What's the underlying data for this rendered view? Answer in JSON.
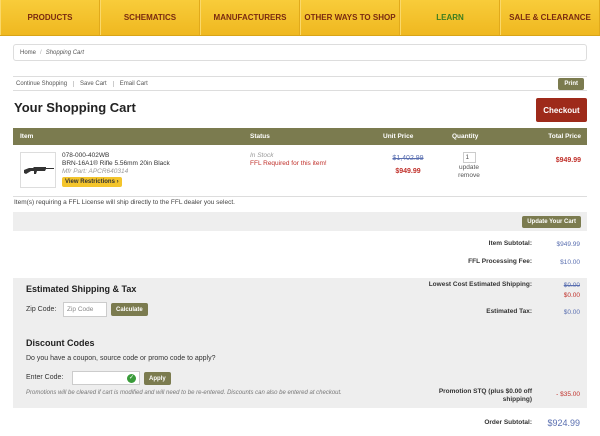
{
  "nav": {
    "items": [
      "PRODUCTS",
      "SCHEMATICS",
      "MANUFACTURERS",
      "OTHER WAYS TO SHOP",
      "LEARN",
      "SALE & CLEARANCE"
    ]
  },
  "breadcrumb": {
    "home": "Home",
    "separator": "/",
    "current": "Shopping Cart"
  },
  "actions": {
    "continue": "Continue Shopping",
    "save": "Save Cart",
    "email": "Email Cart",
    "print": "Print"
  },
  "page_title": "Your Shopping Cart",
  "checkout_label": "Checkout",
  "table": {
    "headers": {
      "item": "Item",
      "status": "Status",
      "unit_price": "Unit Price",
      "quantity": "Quantity",
      "total": "Total Price"
    }
  },
  "cart_item": {
    "sku": "078-000-402WB",
    "name": "BRN-16A1® Rifle 5.56mm 20in Black",
    "mfr_part": "Mfr Part: APCR640314",
    "view_restrictions": "View Restrictions ›",
    "status_stock": "In Stock",
    "status_ffl": "FFL Required for this item!",
    "old_price": "$1,402.99",
    "new_price": "$949.99",
    "quantity": "1",
    "update": "update",
    "remove": "remove",
    "total": "$949.99"
  },
  "ffl_note": "Item(s) requiring a FFL License will ship directly to the FFL dealer you select.",
  "update_cart": "Update Your Cart",
  "summary": {
    "subtotal_label": "Item Subtotal:",
    "subtotal_value": "$949.99",
    "ffl_fee_label": "FFL Processing Fee:",
    "ffl_fee_value": "$10.00",
    "shipping_label": "Lowest Cost Estimated Shipping:",
    "shipping_old": "$0.00",
    "shipping_new": "$0.00",
    "tax_label": "Estimated Tax:",
    "tax_value": "$0.00",
    "promo_label": "Promotion STQ (plus $0.00 off shipping)",
    "promo_value": "- $35.00",
    "order_subtotal_label": "Order Subtotal:",
    "order_subtotal_value": "$924.99"
  },
  "shipping": {
    "title": "Estimated Shipping & Tax",
    "zip_label": "Zip Code:",
    "zip_placeholder": "Zip Code",
    "calculate": "Calculate"
  },
  "discount": {
    "title": "Discount Codes",
    "question": "Do you have a coupon, source code or promo code to apply?",
    "enter_label": "Enter Code:",
    "apply": "Apply",
    "note": "Promotions will be cleared if cart is modified and will need to be re-entered. Discounts can also be entered at checkout."
  },
  "colors": {
    "nav_bg": "#f4c52c",
    "accent_olive": "#7b7b4f",
    "checkout_red": "#9e2a1a",
    "price_red": "#c0302a",
    "price_blue": "#5a6fb0"
  }
}
